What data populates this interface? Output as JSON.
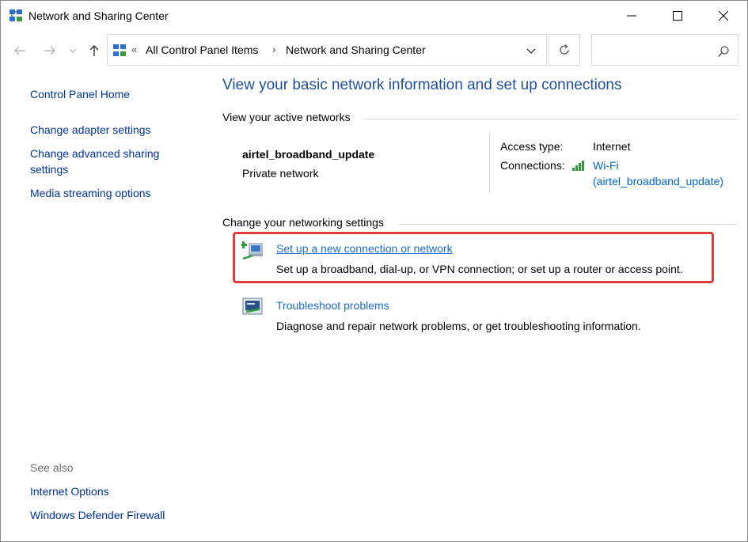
{
  "window": {
    "title": "Network and Sharing Center"
  },
  "navigation": {
    "breadcrumb_root": "All Control Panel Items",
    "breadcrumb_current": "Network and Sharing Center",
    "search_placeholder": ""
  },
  "sidebar": {
    "links": [
      "Control Panel Home",
      "Change adapter settings",
      "Change advanced sharing",
      "settings",
      "Media streaming options"
    ],
    "see_also_header": "See also",
    "see_also": [
      "Internet Options",
      "Windows Defender Firewall"
    ]
  },
  "main": {
    "title": "View your basic network information and set up connections",
    "active_networks_header": "View your active networks",
    "network": {
      "name": "airtel_broadband_update",
      "category": "Private network",
      "access_type_label": "Access type:",
      "access_type_value": "Internet",
      "connections_label": "Connections:",
      "connection_link_line1": "Wi-Fi",
      "connection_link_line2": "(airtel_broadband_update)"
    },
    "change_settings_header": "Change your networking settings",
    "tasks": [
      {
        "link": "Set up a new connection or network",
        "description": "Set up a broadband, dial-up, or VPN connection; or set up a router or access point."
      },
      {
        "link": "Troubleshoot problems",
        "description": "Diagnose and repair network problems, or get troubleshooting information."
      }
    ]
  },
  "colors": {
    "title_blue": "#1e4e9c",
    "link_blue": "#003399",
    "highlight_red": "#e03c3c"
  }
}
